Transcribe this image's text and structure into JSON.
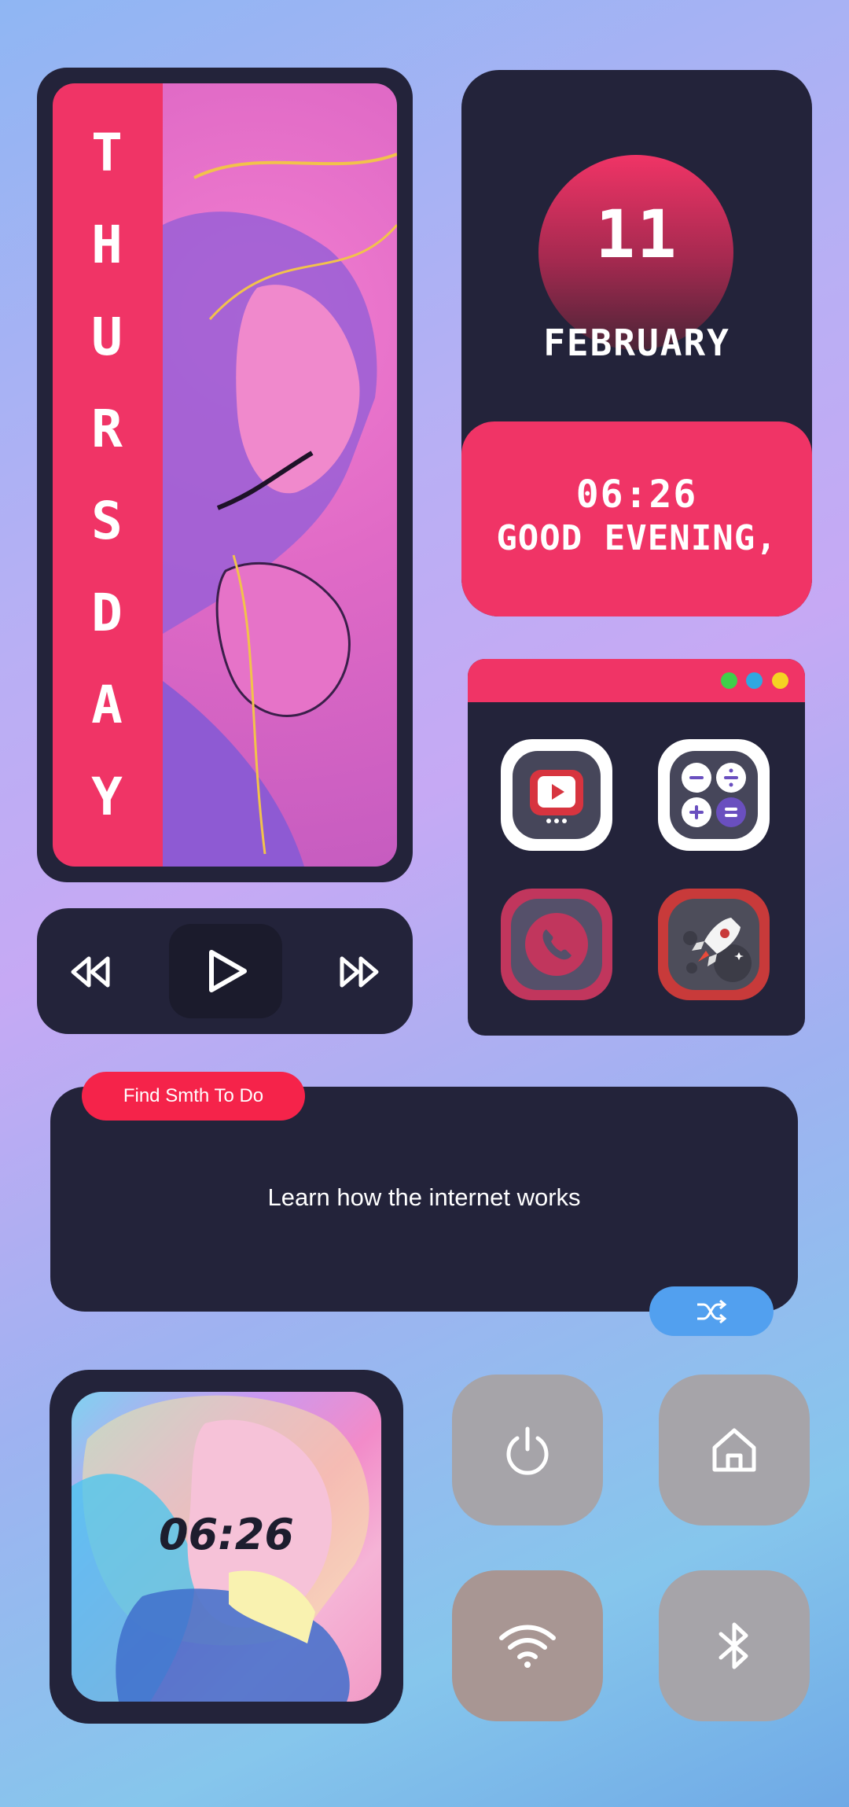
{
  "day_widget": {
    "letters": [
      "T",
      "H",
      "U",
      "R",
      "S",
      "D",
      "A",
      "Y"
    ]
  },
  "date_widget": {
    "day": "11",
    "month": "FEBRUARY"
  },
  "greeting": {
    "time": "06:26",
    "text": "GOOD EVENING,"
  },
  "app_launcher": {
    "dots": [
      "#3fd04a",
      "#2fa8e0",
      "#f5d323"
    ],
    "apps": [
      {
        "icon": "video-player-icon"
      },
      {
        "icon": "calculator-icon"
      },
      {
        "icon": "phone-icon"
      },
      {
        "icon": "rocket-icon"
      }
    ]
  },
  "player": {
    "prev_icon": "rewind-icon",
    "play_icon": "play-icon",
    "next_icon": "fast-forward-icon"
  },
  "todo": {
    "tag": "Find Smth To Do",
    "task": "Learn how the internet works",
    "shuffle_icon": "shuffle-icon"
  },
  "clock_widget": {
    "time": "06:26"
  },
  "controls": [
    {
      "icon": "power-icon"
    },
    {
      "icon": "home-icon"
    },
    {
      "icon": "wifi-icon"
    },
    {
      "icon": "bluetooth-icon"
    }
  ],
  "colors": {
    "accent": "#f03466",
    "panel": "#23233a",
    "tag": "#f5234a",
    "shuffle": "#52a0ef",
    "control": "#a6a4a9"
  }
}
